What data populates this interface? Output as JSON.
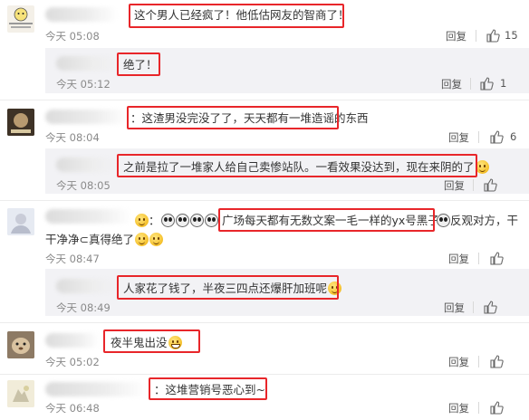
{
  "reply_label": "回复",
  "comments": [
    {
      "text": "这个男人已经疯了！他低估网友的智商了！",
      "time": "今天 05:08",
      "likes": "15"
    },
    {
      "text": "绝了！",
      "time": "今天 05:12",
      "likes": "1"
    },
    {
      "text": "：这渣男没完没了了，天天都有一堆造谣的东西",
      "time": "今天 08:04",
      "likes": "6"
    },
    {
      "text": "之前是拉了一堆家人给自己卖惨站队。一看效果没达到，现在来阴的了",
      "time": "今天 08:05",
      "likes": ""
    },
    {
      "text_prefix": "：",
      "text_highlight": "广场每天都有无数文案一毛一样的yx号黑子",
      "text_suffix": "反观对方，干",
      "text_line2": "干净净⊂真得绝了",
      "time": "今天 08:47",
      "likes": ""
    },
    {
      "text": "人家花了钱了，半夜三四点还爆肝加班呢",
      "time": "今天 08:49",
      "likes": ""
    },
    {
      "text": "夜半鬼出没",
      "time": "今天 05:02",
      "likes": ""
    },
    {
      "text": "：这堆营销号恶心到~",
      "time": "今天 06:48",
      "likes": ""
    }
  ],
  "colors": {
    "highlight": "#e8262a",
    "sub_background": "#f2f2f5"
  }
}
